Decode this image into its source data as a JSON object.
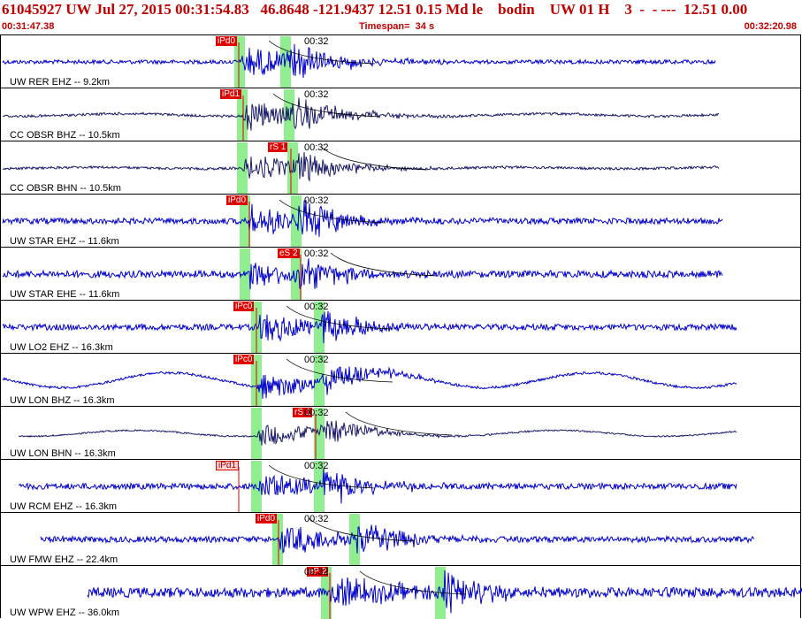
{
  "header": {
    "title": "61045927 UW Jul 27, 2015 00:31:54.83   46.8648 -121.9437 12.51 0.15 Md le    bodin    UW 01 H    3  -  - ---  12.51 0.00",
    "start_time": "00:31:47.38",
    "timespan": "Timespan=  34 s",
    "end_time": "00:32:20.98"
  },
  "colors": {
    "title": "#c00000",
    "trace_blue": "#0000cc",
    "trace_dark": "#1a1a6a",
    "pick": "#e00000",
    "window": "#90ee90"
  },
  "traces": [
    {
      "label": "UW RER EHZ -- 9.2km",
      "pick": "iPd0",
      "clock": "00:32",
      "color": "#0000cc",
      "amp": 0.9,
      "noise": 0.08,
      "wave": 0,
      "start": 2,
      "end": 808,
      "p": 270,
      "s": 322,
      "pickx": 243,
      "light": false
    },
    {
      "label": "CC OBSR BHZ -- 10.5km",
      "pick": "iPd1",
      "clock": "00:32",
      "color": "#1a1a6a",
      "amp": 0.85,
      "noise": 0.05,
      "wave": 0.05,
      "start": 2,
      "end": 812,
      "p": 273,
      "s": 326,
      "pickx": 248,
      "light": false
    },
    {
      "label": "CC OBSR BHN -- 10.5km",
      "pick": "rS 1",
      "clock": "00:32",
      "color": "#1a1a6a",
      "amp": 0.75,
      "noise": 0.05,
      "wave": 0.03,
      "start": 2,
      "end": 812,
      "p": 273,
      "s": 330,
      "pickx": 302,
      "light": false
    },
    {
      "label": "UW STAR EHZ -- 11.6km",
      "pick": "iPd0",
      "clock": "00:32",
      "color": "#0000cc",
      "amp": 0.85,
      "noise": 0.12,
      "wave": 0,
      "start": 2,
      "end": 816,
      "p": 276,
      "s": 334,
      "pickx": 255,
      "light": false
    },
    {
      "label": "UW STAR EHE -- 11.6km",
      "pick": "eS 2",
      "clock": "00:32",
      "color": "#0000cc",
      "amp": 0.75,
      "noise": 0.14,
      "wave": 0,
      "start": 2,
      "end": 816,
      "p": 276,
      "s": 334,
      "pickx": 313,
      "light": false
    },
    {
      "label": "UW LO2 EHZ -- 16.3km",
      "pick": "iPc0",
      "clock": "00:32",
      "color": "#0000cc",
      "amp": 0.85,
      "noise": 0.12,
      "wave": 0,
      "start": 2,
      "end": 832,
      "p": 289,
      "s": 360,
      "pickx": 263,
      "light": false
    },
    {
      "label": "UW LON BHZ -- 16.3km",
      "pick": "iPc0",
      "clock": "00:32",
      "color": "#0000cc",
      "amp": 0.8,
      "noise": 0.05,
      "wave": 0.3,
      "start": 2,
      "end": 832,
      "p": 289,
      "s": 360,
      "pickx": 263,
      "light": false
    },
    {
      "label": "UW LON BHN -- 16.3km",
      "pick": "rS 1",
      "clock": "00:32",
      "color": "#1a1a6a",
      "amp": 0.65,
      "noise": 0.03,
      "wave": 0.12,
      "start": 20,
      "end": 832,
      "p": 289,
      "s": 360,
      "pickx": 330,
      "light": false
    },
    {
      "label": "UW RCM EHZ -- 16.3km",
      "pick": "iPd1",
      "clock": "00:32",
      "color": "#0000cc",
      "amp": 0.8,
      "noise": 0.12,
      "wave": 0,
      "start": 20,
      "end": 832,
      "p": 289,
      "s": 360,
      "pickx": 243,
      "light": true
    },
    {
      "label": "UW FMW EHZ -- 22.4km",
      "pick": "iPd0",
      "clock": "00:32",
      "color": "#0000cc",
      "amp": 0.9,
      "noise": 0.12,
      "wave": 0,
      "start": 45,
      "end": 852,
      "p": 313,
      "s": 400,
      "pickx": 288,
      "light": false
    },
    {
      "label": "UW WPW EHZ -- 36.0km",
      "pick": "eP 2",
      "clock": "00:32",
      "color": "#0000cc",
      "amp": 0.95,
      "noise": 0.2,
      "wave": 0,
      "start": 98,
      "end": 906,
      "p": 368,
      "s": 497,
      "pickx": 346,
      "light": false
    }
  ]
}
